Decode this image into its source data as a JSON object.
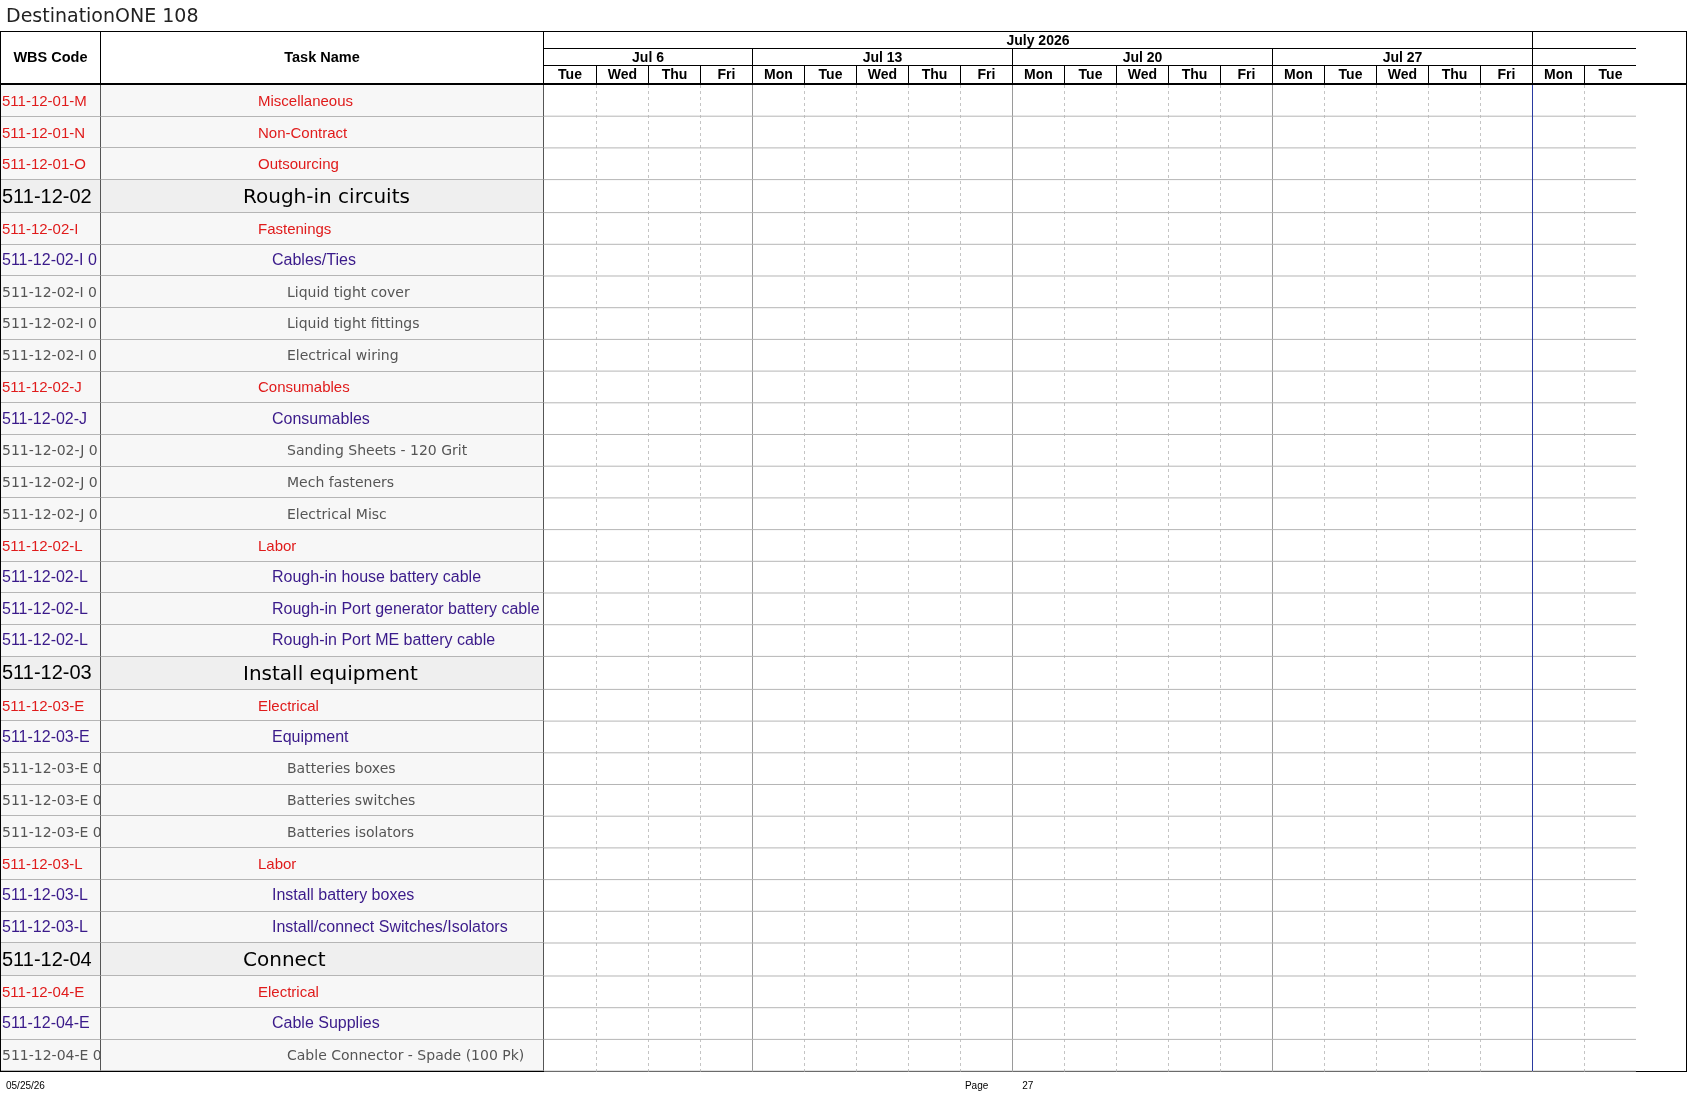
{
  "title": "DestinationONE 108",
  "columns": [
    {
      "label": "WBS Code"
    },
    {
      "label": "Task Name"
    }
  ],
  "timescale": [
    {
      "label": "July 2026",
      "weeks": [
        {
          "label": "Jul 6",
          "today_line": false,
          "days": [
            "Tue",
            "Wed",
            "Thu",
            "Fri"
          ]
        },
        {
          "label": "Jul 13",
          "today_line": false,
          "days": [
            "Mon",
            "Tue",
            "Wed",
            "Thu",
            "Fri"
          ]
        },
        {
          "label": "Jul 20",
          "today_line": false,
          "days": [
            "Mon",
            "Tue",
            "Wed",
            "Thu",
            "Fri"
          ]
        },
        {
          "label": "Jul 27",
          "today_line": false,
          "days": [
            "Mon",
            "Tue",
            "Wed",
            "Thu",
            "Fri"
          ]
        }
      ]
    },
    {
      "weeks": [
        {
          "today_line": true,
          "days": [
            "Mon",
            "Tue"
          ]
        }
      ]
    }
  ],
  "rows": [
    {
      "kind": "category",
      "wbs": "511-12-01-M",
      "name": "Miscellaneous"
    },
    {
      "kind": "category",
      "wbs": "511-12-01-N",
      "name": "Non-Contract"
    },
    {
      "kind": "category",
      "wbs": "511-12-01-O",
      "name": "Outsourcing"
    },
    {
      "kind": "summary",
      "wbs": "511-12-02",
      "name": "Rough-in circuits",
      "children": [
        {
          "kind": "category",
          "wbs": "511-12-02-I",
          "name": "Fastenings",
          "children": [
            {
              "kind": "group",
              "wbs": "511-12-02-I 0",
              "name": "Cables/Ties",
              "children": [
                {
                  "kind": "item",
                  "wbs": "511-12-02-I 0",
                  "name": "Liquid tight cover"
                },
                {
                  "kind": "item",
                  "wbs": "511-12-02-I 0",
                  "name": "Liquid tight fittings"
                },
                {
                  "kind": "item",
                  "wbs": "511-12-02-I 0",
                  "name": "Electrical wiring"
                }
              ]
            }
          ]
        },
        {
          "kind": "category",
          "wbs": "511-12-02-J",
          "name": "Consumables",
          "children": [
            {
              "kind": "group",
              "wbs": "511-12-02-J",
              "name": "Consumables",
              "children": [
                {
                  "kind": "item",
                  "wbs": "511-12-02-J 0",
                  "name": "Sanding Sheets - 120 Grit"
                },
                {
                  "kind": "item",
                  "wbs": "511-12-02-J 0",
                  "name": "Mech fasteners"
                },
                {
                  "kind": "item",
                  "wbs": "511-12-02-J 0",
                  "name": "Electrical Misc"
                }
              ]
            }
          ]
        },
        {
          "kind": "category",
          "wbs": "511-12-02-L",
          "name": "Labor",
          "children": [
            {
              "kind": "group",
              "wbs": "511-12-02-L",
              "name": "Rough-in house battery cable"
            },
            {
              "kind": "group",
              "wbs": "511-12-02-L",
              "name": "Rough-in Port generator battery cable"
            },
            {
              "kind": "group",
              "wbs": "511-12-02-L",
              "name": "Rough-in Port ME battery cable"
            }
          ]
        }
      ]
    },
    {
      "kind": "summary",
      "wbs": "511-12-03",
      "name": "Install equipment",
      "children": [
        {
          "kind": "category",
          "wbs": "511-12-03-E",
          "name": "Electrical",
          "children": [
            {
              "kind": "group",
              "wbs": "511-12-03-E",
              "name": "Equipment",
              "children": [
                {
                  "kind": "item",
                  "wbs": "511-12-03-E 0",
                  "name": "Batteries boxes"
                },
                {
                  "kind": "item",
                  "wbs": "511-12-03-E 0",
                  "name": "Batteries switches"
                },
                {
                  "kind": "item",
                  "wbs": "511-12-03-E 0",
                  "name": "Batteries isolators"
                }
              ]
            }
          ]
        },
        {
          "kind": "category",
          "wbs": "511-12-03-L",
          "name": "Labor",
          "children": [
            {
              "kind": "group",
              "wbs": "511-12-03-L",
              "name": "Install battery boxes"
            },
            {
              "kind": "group",
              "wbs": "511-12-03-L",
              "name": "Install/connect Switches/Isolators"
            }
          ]
        }
      ]
    },
    {
      "kind": "summary",
      "wbs": "511-12-04",
      "name": "Connect",
      "children": [
        {
          "kind": "category",
          "wbs": "511-12-04-E",
          "name": "Electrical",
          "children": [
            {
              "kind": "group",
              "wbs": "511-12-04-E",
              "name": "Cable Supplies",
              "children": [
                {
                  "kind": "item",
                  "wbs": "511-12-04-E 0",
                  "name": "Cable Connector - Spade  (100 Pk)"
                }
              ]
            }
          ]
        }
      ]
    }
  ],
  "footer": {
    "date": "05/25/26",
    "page_label": "Page",
    "page_number": "27"
  }
}
